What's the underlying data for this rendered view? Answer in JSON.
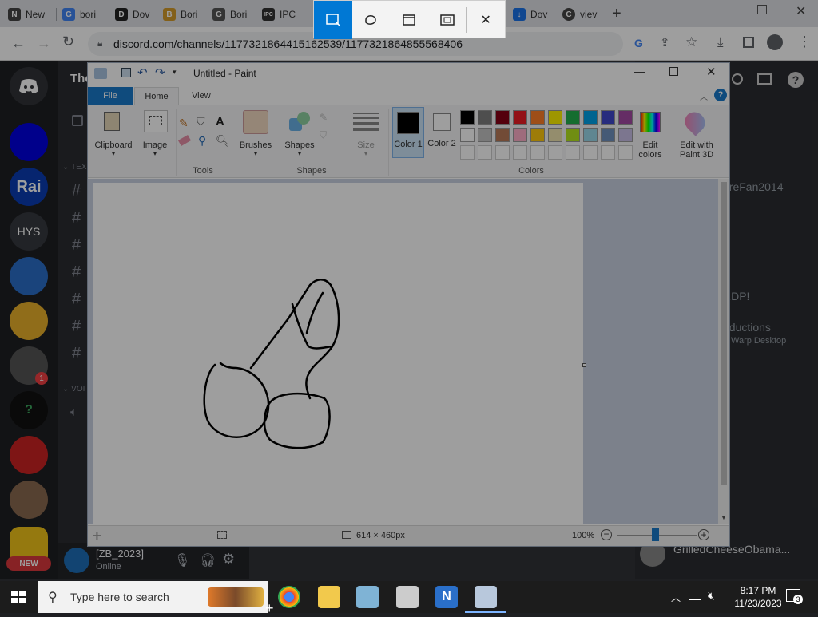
{
  "browser": {
    "tabs": [
      {
        "label": "New",
        "favicon": "N"
      },
      {
        "label": "bori",
        "favicon": "G"
      },
      {
        "label": "Dov",
        "favicon": "D"
      },
      {
        "label": "Bori",
        "favicon": "B"
      },
      {
        "label": "Bori",
        "favicon": "G"
      },
      {
        "label": "IPC",
        "favicon": "IPC"
      },
      {
        "label": "Dov",
        "favicon": "down"
      },
      {
        "label": "viev",
        "favicon": "C"
      }
    ],
    "url": "discord.com/channels/1177321864415162539/1177321864855568406"
  },
  "snip_toolbar": {
    "modes": [
      "rectangle-snip",
      "freeform-snip",
      "window-snip",
      "fullscreen-snip",
      "close"
    ]
  },
  "discord": {
    "server_title": "The",
    "guild_labels": [
      "Rai",
      "HYS"
    ],
    "guild_badge": "1",
    "new_label": "NEW",
    "categories": [
      "TEX",
      "VOI"
    ],
    "user": {
      "name": "[ZB_2023]",
      "status": "Online"
    },
    "member_partial": [
      "oreFan2014",
      "a",
      "RDP!",
      "oductions",
      "Warp Desktop"
    ],
    "member_bottom": "GrilledCheeseObama..."
  },
  "paint": {
    "title": "Untitled - Paint",
    "tabs": {
      "file": "File",
      "home": "Home",
      "view": "View"
    },
    "ribbon": {
      "clipboard": "Clipboard",
      "image": "Image",
      "tools_group": "Tools",
      "brushes": "Brushes",
      "shapes": "Shapes",
      "shapes_group": "Shapes",
      "size": "Size",
      "color1": "Color 1",
      "color2": "Color 2",
      "edit_colors": "Edit colors",
      "edit_paint3d": "Edit with Paint 3D",
      "colors_group": "Colors"
    },
    "palette_row1": [
      "#000000",
      "#7f7f7f",
      "#880015",
      "#ed1c24",
      "#ff7f27",
      "#fff200",
      "#22b14c",
      "#00a2e8",
      "#3f48cc",
      "#a349a4"
    ],
    "palette_row2": [
      "#ffffff",
      "#c3c3c3",
      "#b97a57",
      "#ffaec9",
      "#ffc90e",
      "#efe4b0",
      "#b5e61d",
      "#99d9ea",
      "#7092be",
      "#c8bfe7"
    ],
    "status": {
      "dimensions": "614 × 460px",
      "zoom": "100%"
    }
  },
  "taskbar": {
    "search_placeholder": "Type here to search",
    "time": "8:17 PM",
    "date": "11/23/2023",
    "notification_count": "3"
  }
}
